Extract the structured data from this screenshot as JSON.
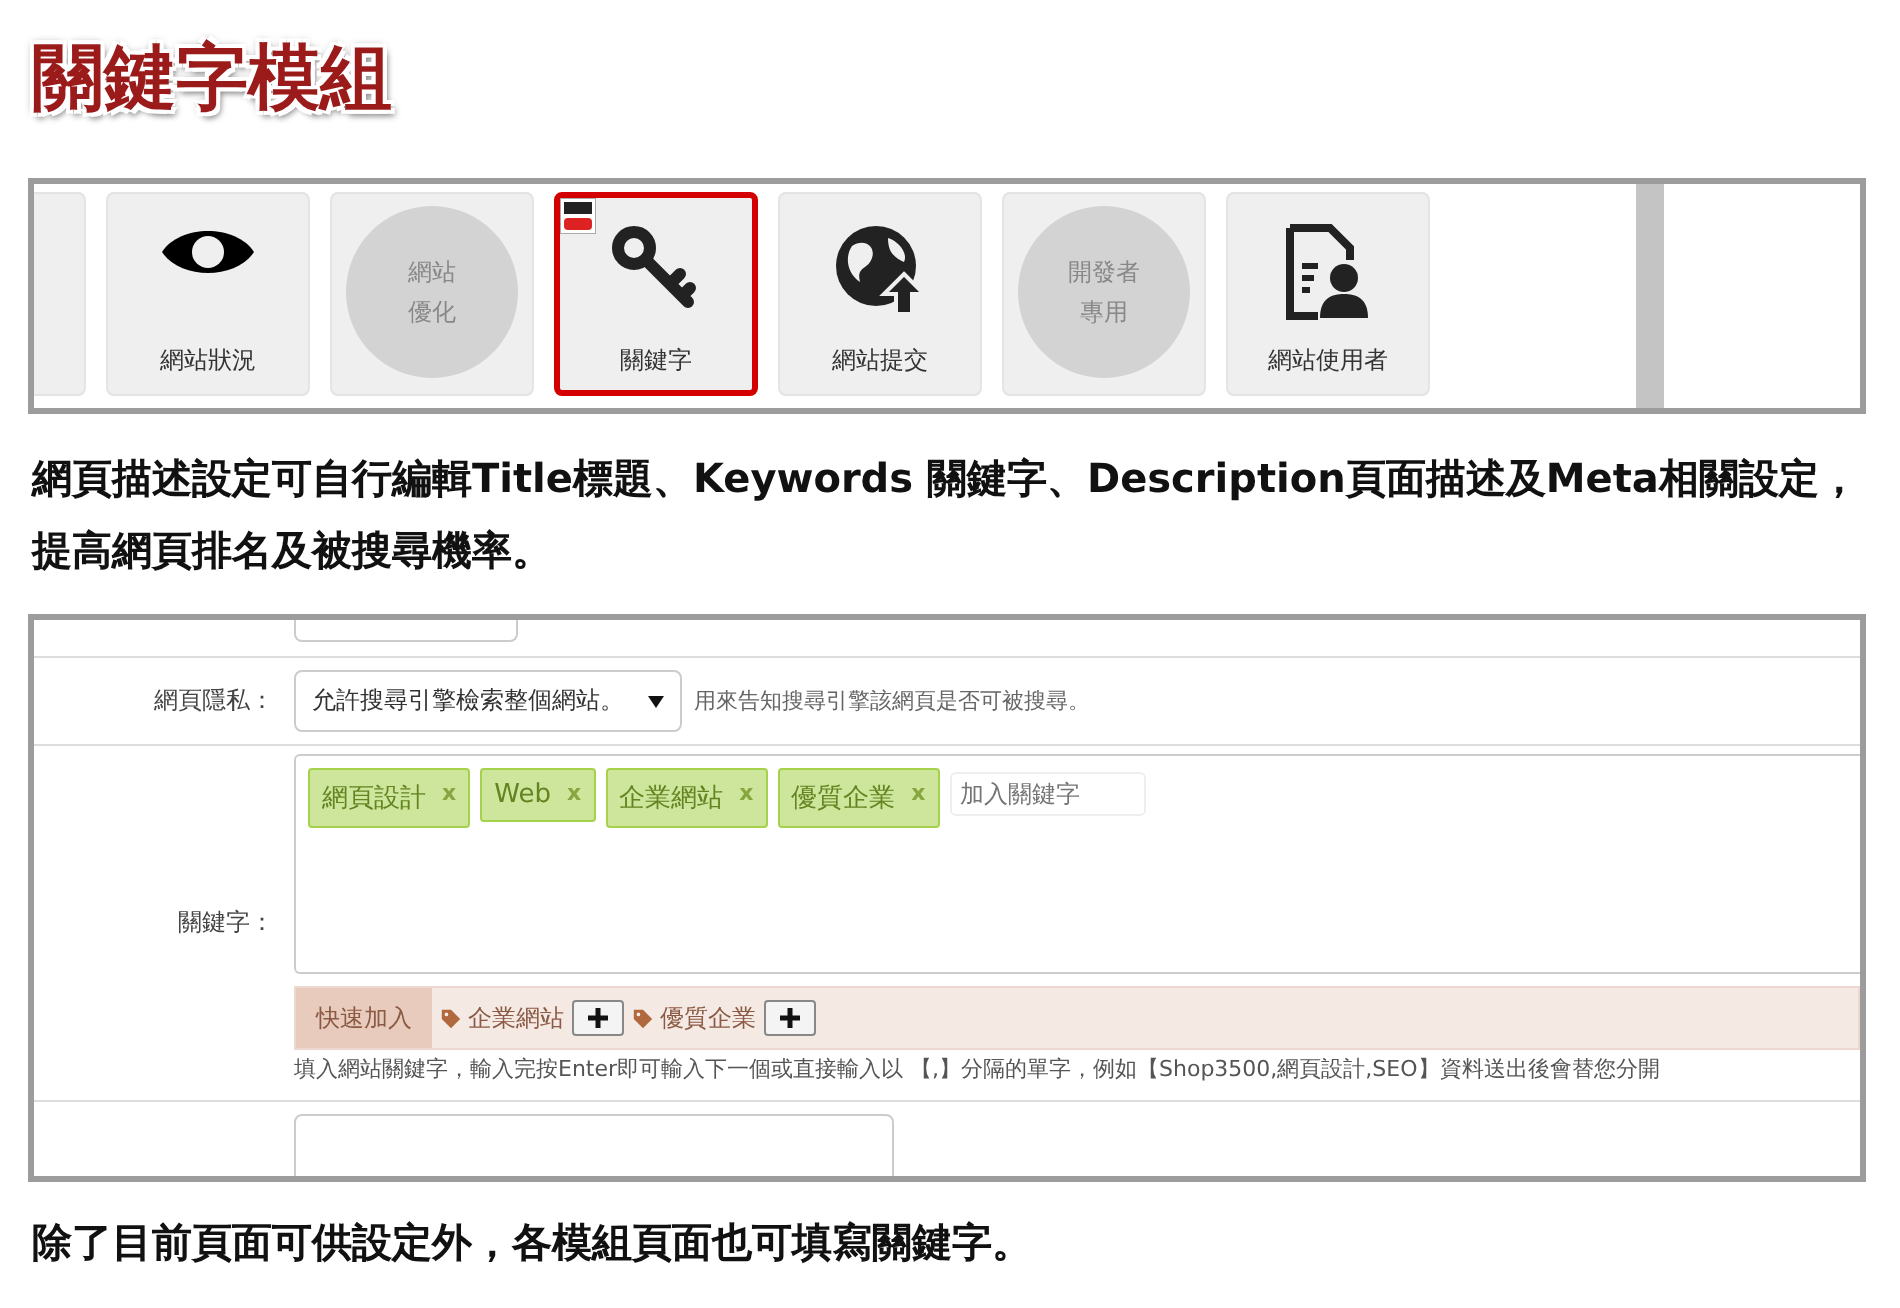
{
  "title": "關鍵字模組",
  "modules": [
    {
      "kind": "partial"
    },
    {
      "kind": "eye",
      "label": "網站狀況",
      "selected": false
    },
    {
      "kind": "circle",
      "label": "網站優化",
      "selected": false
    },
    {
      "kind": "key",
      "label": "關鍵字",
      "selected": true,
      "badge": true
    },
    {
      "kind": "globe",
      "label": "網站提交",
      "selected": false
    },
    {
      "kind": "circle",
      "label": "開發者專用",
      "selected": false
    },
    {
      "kind": "user-doc",
      "label": "網站使用者",
      "selected": false
    }
  ],
  "intro": "網頁描述設定可自行編輯Title標題、Keywords 關鍵字、Description頁面描述及Meta相關設定，提高網頁排名及被搜尋機率。",
  "form": {
    "privacy": {
      "label": "網頁隱私：",
      "value": "允許搜尋引擎檢索整個網站。",
      "hint": "用來告知搜尋引擎該網頁是否可被搜尋。"
    },
    "keywords": {
      "label": "關鍵字：",
      "tags": [
        {
          "text": "網頁設計",
          "remove": "x"
        },
        {
          "text": "Web",
          "remove": "x"
        },
        {
          "text": "企業網站",
          "remove": "x"
        },
        {
          "text": "優質企業",
          "remove": "x"
        }
      ],
      "placeholder": "加入關鍵字",
      "quick_label": "快速加入",
      "quick": [
        "企業網站",
        "優質企業"
      ],
      "help": "填入網站關鍵字，輸入完按Enter即可輸入下一個或直接輸入以 【,】分隔的單字，例如【Shop3500,網頁設計,SEO】資料送出後會替您分開"
    }
  },
  "footer": "除了目前頁面可供設定外，各模組頁面也可填寫關鍵字。"
}
